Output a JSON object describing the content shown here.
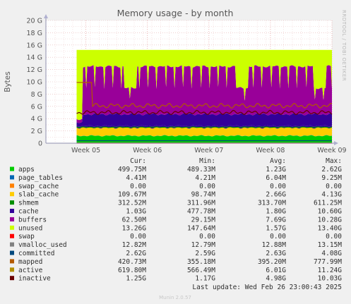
{
  "chart_data": {
    "type": "area",
    "title": "Memory usage - by month",
    "ylabel": "Bytes",
    "watermark": "RRDTOOL / TOBI OETIKER",
    "x_ticks": [
      "Week 05",
      "Week 06",
      "Week 07",
      "Week 08",
      "Week 09"
    ],
    "y_ticks": [
      "20 G",
      "18 G",
      "16 G",
      "14 G",
      "12 G",
      "10 G",
      "8 G",
      "6 G",
      "4 G",
      "2 G",
      "0"
    ],
    "ylim": [
      0,
      20
    ],
    "y_unit": "GB",
    "grid": true,
    "data_start_week": 4.85,
    "data_end_week": 9.0,
    "unused_band_top_gb": 15.2,
    "series": [
      {
        "name": "apps",
        "color": "#00cc00",
        "level_gb": 1.23
      },
      {
        "name": "page_tables",
        "color": "#0066b3",
        "level_gb": 0.006
      },
      {
        "name": "swap_cache",
        "color": "#ff8000",
        "level_gb": 0.0
      },
      {
        "name": "slab_cache",
        "color": "#ffcc00",
        "level_gb": 2.66
      },
      {
        "name": "shmem",
        "color": "#330099",
        "level_gb": 0.31
      },
      {
        "name": "cache",
        "color": "#330099",
        "level_gb": 1.8
      },
      {
        "name": "buffers",
        "color": "#990099",
        "level_gb": 7.69
      },
      {
        "name": "unused",
        "color": "#ccff00",
        "level_gb": 1.57
      },
      {
        "name": "swap",
        "color": "#ff0000",
        "level_gb": 0.0
      },
      {
        "name": "vmalloc_used",
        "color": "#808080",
        "level_gb": 0.013
      },
      {
        "name": "committed",
        "color": "#008f00",
        "level_gb": 2.63
      },
      {
        "name": "mapped",
        "color": "#00487d",
        "level_gb": 0.395
      },
      {
        "name": "active",
        "color": "#b35a00",
        "level_gb": 6.01
      },
      {
        "name": "inactive",
        "color": "#b38f00",
        "level_gb": 4.98
      }
    ],
    "legend_header": [
      "Cur:",
      "Min:",
      "Avg:",
      "Max:"
    ],
    "legend_rows": [
      {
        "name": "apps",
        "color": "#00cc00",
        "cur": "499.75M",
        "min": "489.33M",
        "avg": "1.23G",
        "max": "2.62G"
      },
      {
        "name": "page_tables",
        "color": "#0066b3",
        "cur": "4.41M",
        "min": "4.21M",
        "avg": "6.04M",
        "max": "9.25M"
      },
      {
        "name": "swap_cache",
        "color": "#ff8000",
        "cur": "0.00",
        "min": "0.00",
        "avg": "0.00",
        "max": "0.00"
      },
      {
        "name": "slab_cache",
        "color": "#ffcc00",
        "cur": "109.67M",
        "min": "98.74M",
        "avg": "2.66G",
        "max": "4.13G"
      },
      {
        "name": "shmem",
        "color": "#008f00",
        "cur": "312.52M",
        "min": "311.96M",
        "avg": "313.70M",
        "max": "611.25M"
      },
      {
        "name": "cache",
        "color": "#330099",
        "cur": "1.03G",
        "min": "477.78M",
        "avg": "1.80G",
        "max": "10.60G"
      },
      {
        "name": "buffers",
        "color": "#990099",
        "cur": "62.50M",
        "min": "29.15M",
        "avg": "7.69G",
        "max": "10.28G"
      },
      {
        "name": "unused",
        "color": "#ccff00",
        "cur": "13.26G",
        "min": "147.64M",
        "avg": "1.57G",
        "max": "13.40G"
      },
      {
        "name": "swap",
        "color": "#ff0000",
        "cur": "0.00",
        "min": "0.00",
        "avg": "0.00",
        "max": "0.00"
      },
      {
        "name": "vmalloc_used",
        "color": "#808080",
        "cur": "12.82M",
        "min": "12.79M",
        "avg": "12.88M",
        "max": "13.15M"
      },
      {
        "name": "committed",
        "color": "#00487d",
        "cur": "2.62G",
        "min": "2.59G",
        "avg": "2.63G",
        "max": "4.08G"
      },
      {
        "name": "mapped",
        "color": "#b35a00",
        "cur": "420.73M",
        "min": "355.18M",
        "avg": "395.20M",
        "max": "777.99M"
      },
      {
        "name": "active",
        "color": "#b38f00",
        "cur": "619.80M",
        "min": "566.49M",
        "avg": "6.01G",
        "max": "11.24G"
      },
      {
        "name": "inactive",
        "color": "#6b0000",
        "cur": "1.25G",
        "min": "1.17G",
        "avg": "4.98G",
        "max": "10.03G"
      }
    ],
    "last_update": "Last update: Wed Feb 26 23:00:43 2025",
    "footer": "Munin 2.0.57"
  }
}
